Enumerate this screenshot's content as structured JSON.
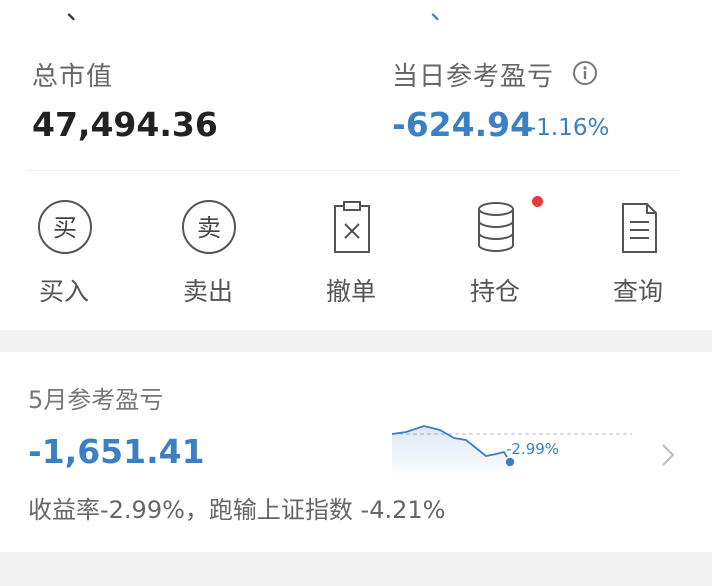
{
  "top_partial": {
    "left_char": "、",
    "right_char": "、"
  },
  "summary": {
    "total_label": "总市值",
    "total_value": "47,494.36",
    "daily_pnl_label": "当日参考盈亏",
    "daily_pnl_value": "-624.94",
    "daily_pnl_pct": "-1.16%"
  },
  "actions": [
    {
      "label": "买入",
      "icon": "buy-circle-icon",
      "glyph": "买"
    },
    {
      "label": "卖出",
      "icon": "sell-circle-icon",
      "glyph": "卖"
    },
    {
      "label": "撤单",
      "icon": "cancel-order-clipboard-icon"
    },
    {
      "label": "持仓",
      "icon": "holdings-database-icon",
      "badge": "red-dot"
    },
    {
      "label": "查询",
      "icon": "query-document-icon"
    }
  ],
  "monthly": {
    "label": "5月参考盈亏",
    "value": "-1,651.41",
    "sparkline_end_label": "-2.99%",
    "yield_text": "收益率-2.99%，跑输上证指数 -4.21%"
  },
  "colors": {
    "accent_blue": "#3b7fc4",
    "badge_red": "#e63a3a",
    "text_dark": "#222222"
  }
}
